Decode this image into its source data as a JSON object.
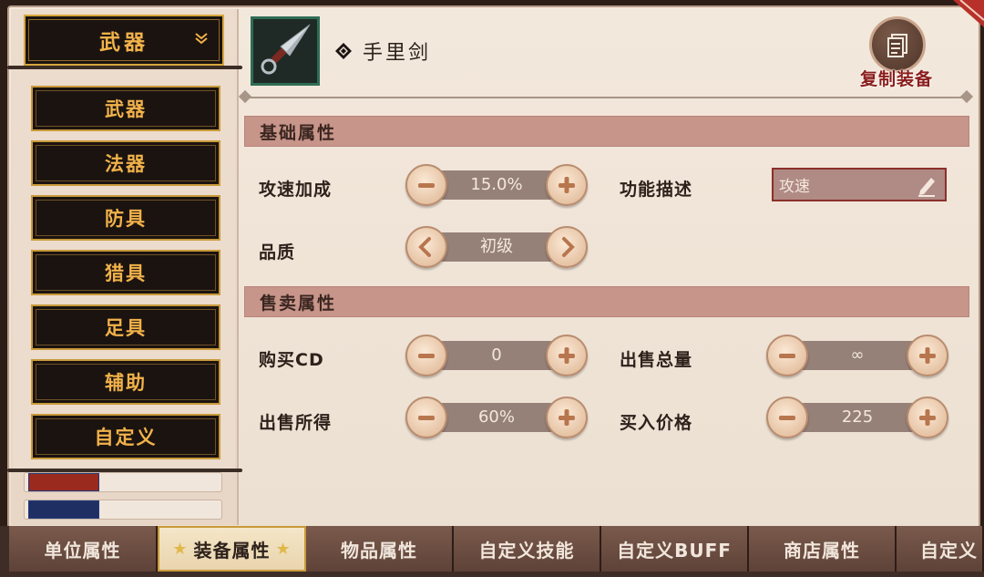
{
  "category_dropdown": {
    "selected": "武器"
  },
  "category_menu": [
    "武器",
    "法器",
    "防具",
    "猎具",
    "足具",
    "辅助",
    "自定义"
  ],
  "item": {
    "name": "手里剑"
  },
  "copy_button": {
    "label": "复制装备"
  },
  "sections": {
    "basic": {
      "title": "基础属性",
      "attack_speed": {
        "label": "攻速加成",
        "value": "15.0%"
      },
      "description": {
        "label": "功能描述",
        "value": "攻速"
      },
      "quality": {
        "label": "品质",
        "value": "初级"
      }
    },
    "sale": {
      "title": "售卖属性",
      "buy_cd": {
        "label": "购买CD",
        "value": "0"
      },
      "total_stock": {
        "label": "出售总量",
        "value": "∞"
      },
      "sell_return": {
        "label": "出售所得",
        "value": "60%"
      },
      "buy_price": {
        "label": "买入价格",
        "value": "225"
      }
    }
  },
  "tabs": [
    "单位属性",
    "装备属性",
    "物品属性",
    "自定义技能",
    "自定义BUFF",
    "商店属性",
    "自定义"
  ],
  "active_tab": "装备属性"
}
